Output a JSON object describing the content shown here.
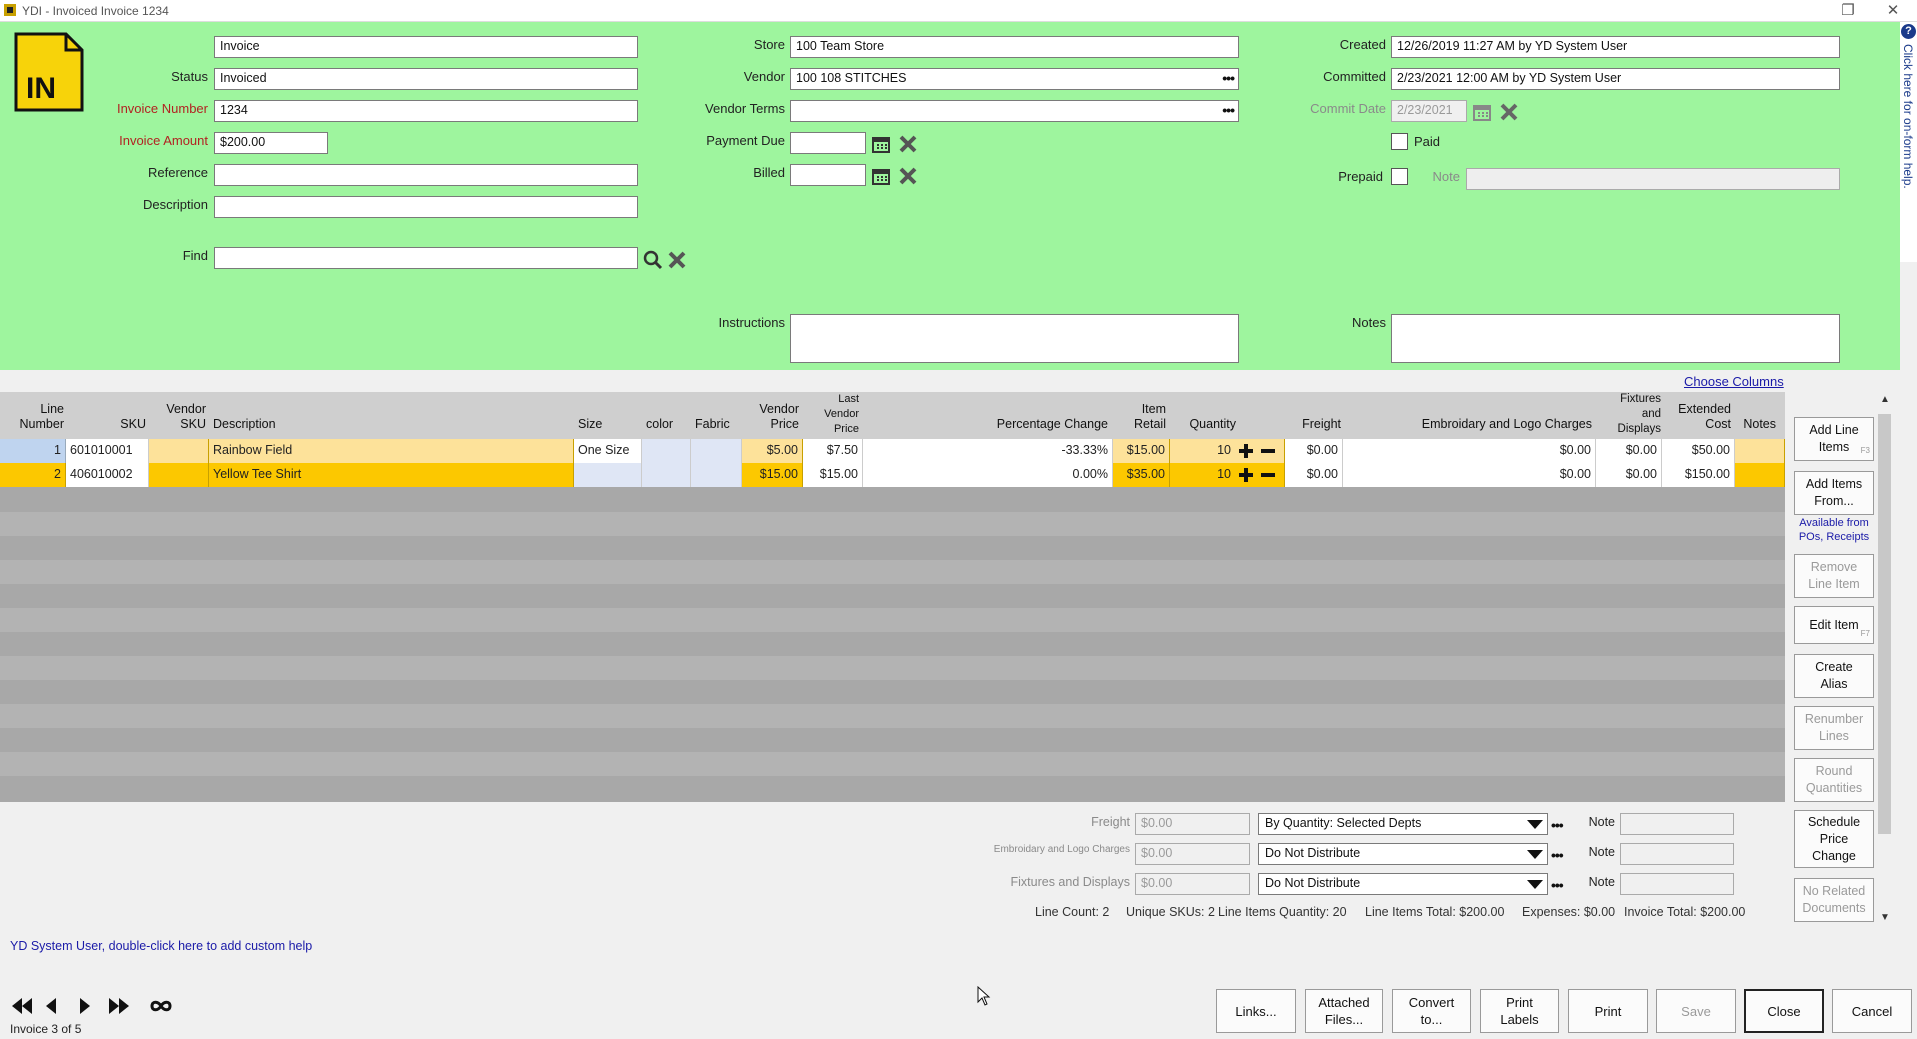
{
  "window": {
    "title": "YDI - Invoiced Invoice 1234"
  },
  "header": {
    "logo_text": "IN",
    "type_value": "Invoice",
    "status_label": "Status",
    "status_value": "Invoiced",
    "invoice_number_label": "Invoice Number",
    "invoice_number_value": "1234",
    "invoice_amount_label": "Invoice Amount",
    "invoice_amount_value": "$200.00",
    "reference_label": "Reference",
    "reference_value": "",
    "description_label": "Description",
    "description_value": "",
    "find_label": "Find",
    "find_value": "",
    "store_label": "Store",
    "store_value": "100 Team Store",
    "vendor_label": "Vendor",
    "vendor_value": "100 108 STITCHES",
    "vendor_terms_label": "Vendor Terms",
    "vendor_terms_value": "",
    "payment_due_label": "Payment Due",
    "payment_due_value": "",
    "billed_label": "Billed",
    "billed_value": "",
    "instructions_label": "Instructions",
    "instructions_value": "",
    "created_label": "Created",
    "created_value": "12/26/2019 11:27 AM by YD System User",
    "committed_label": "Committed",
    "committed_value": "2/23/2021 12:00 AM by YD System User",
    "commit_date_label": "Commit Date",
    "commit_date_value": "2/23/2021",
    "paid_label": "Paid",
    "prepaid_label": "Prepaid",
    "note_label": "Note",
    "note_value": "",
    "notes_label": "Notes",
    "notes_value": ""
  },
  "help_tab": {
    "text": "Click here for on-form help."
  },
  "choose_columns": "Choose Columns",
  "grid": {
    "columns": [
      "Line\nNumber",
      "SKU",
      "Vendor\nSKU",
      "Description",
      "Size",
      "color",
      "Fabric",
      "Vendor\nPrice",
      "Last\nVendor\nPrice",
      "Percentage Change",
      "Item\nRetail",
      "Quantity",
      "Freight",
      "Embroidary and Logo Charges",
      "Fixtures\nand\nDisplays",
      "Extended\nCost",
      "Notes"
    ],
    "rows": [
      {
        "line": "1",
        "sku": "601010001",
        "vendor_sku": "",
        "description": "Rainbow Field",
        "size": "One Size",
        "color": "",
        "fabric": "",
        "vendor_price": "$5.00",
        "last_vendor_price": "$7.50",
        "pct_change": "-33.33%",
        "item_retail": "$15.00",
        "quantity": "10",
        "freight": "$0.00",
        "embroidery": "$0.00",
        "fixtures": "$0.00",
        "extended_cost": "$50.00",
        "notes": ""
      },
      {
        "line": "2",
        "sku": "406010002",
        "vendor_sku": "",
        "description": "Yellow Tee Shirt",
        "size": "",
        "color": "",
        "fabric": "",
        "vendor_price": "$15.00",
        "last_vendor_price": "$15.00",
        "pct_change": "0.00%",
        "item_retail": "$35.00",
        "quantity": "10",
        "freight": "$0.00",
        "embroidery": "$0.00",
        "fixtures": "$0.00",
        "extended_cost": "$150.00",
        "notes": ""
      }
    ]
  },
  "side_buttons": {
    "add_line_items": "Add Line\nItems",
    "add_line_items_key": "F3",
    "add_items_from": "Add Items\nFrom...",
    "available_from": "Available from\nPOs, Receipts",
    "remove_line_item": "Remove\nLine Item",
    "edit_item": "Edit Item",
    "edit_item_key": "F7",
    "create_alias": "Create\nAlias",
    "renumber_lines": "Renumber\nLines",
    "round_quantities": "Round\nQuantities",
    "schedule_price_change": "Schedule\nPrice\nChange",
    "no_related_documents": "No Related\nDocuments"
  },
  "expenses": {
    "freight_label": "Freight",
    "freight_value": "$0.00",
    "freight_dist": "By Quantity: Selected Depts",
    "embroidery_label": "Embroidary and Logo Charges",
    "embroidery_value": "$0.00",
    "embroidery_dist": "Do Not Distribute",
    "fixtures_label": "Fixtures and Displays",
    "fixtures_value": "$0.00",
    "fixtures_dist": "Do Not Distribute",
    "note_label": "Note"
  },
  "totals": {
    "line_count": "Line Count: 2",
    "unique_skus": "Unique SKUs: 2",
    "line_items_quantity": "Line Items Quantity: 20",
    "line_items_total": "Line Items Total: $200.00",
    "expenses": "Expenses: $0.00",
    "invoice_total": "Invoice Total: $200.00"
  },
  "custom_help": "YD System User, double-click here to add custom help",
  "footer": {
    "record_info": "Invoice 3 of 5",
    "links": "Links...",
    "attached_files": "Attached\nFiles...",
    "convert_to": "Convert\nto...",
    "print_labels": "Print\nLabels",
    "print": "Print",
    "save": "Save",
    "close": "Close",
    "cancel": "Cancel"
  }
}
